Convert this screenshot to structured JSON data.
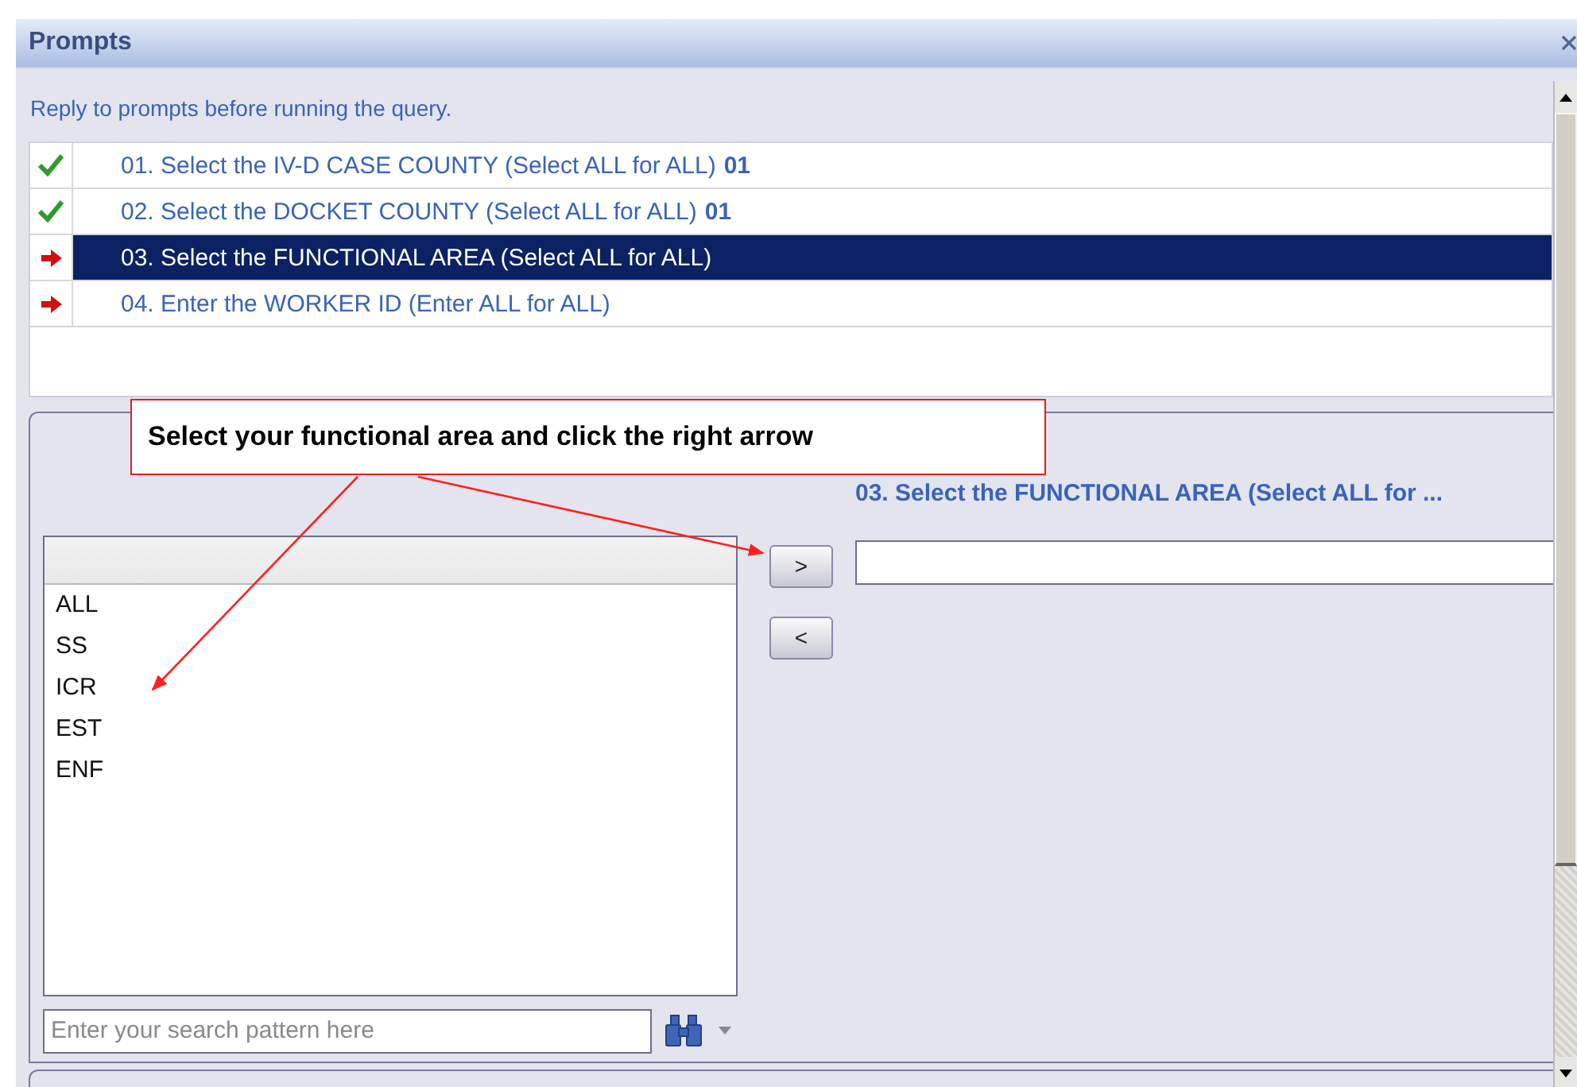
{
  "window": {
    "title": "Prompts"
  },
  "instruction": "Reply to prompts before running the query.",
  "prompts": [
    {
      "label": "01. Select the IV-D CASE COUNTY (Select ALL for ALL)",
      "value": "01",
      "answered": true,
      "selected": false
    },
    {
      "label": "02. Select the DOCKET COUNTY (Select ALL for ALL)",
      "value": "01",
      "answered": true,
      "selected": false
    },
    {
      "label": "03. Select the FUNCTIONAL AREA (Select ALL for ALL)",
      "answered": false,
      "selected": true
    },
    {
      "label": "04. Enter the WORKER ID (Enter ALL for ALL)",
      "answered": false,
      "selected": false
    }
  ],
  "callout": "Select your functional area and click the right arrow",
  "available_values": [
    "ALL",
    "SS",
    "ICR",
    "EST",
    "ENF"
  ],
  "search": {
    "placeholder": "Enter your search pattern here"
  },
  "add_button": ">",
  "remove_button": "<",
  "selected_values": {
    "label": "03. Select the FUNCTIONAL AREA (Select ALL for ..."
  }
}
